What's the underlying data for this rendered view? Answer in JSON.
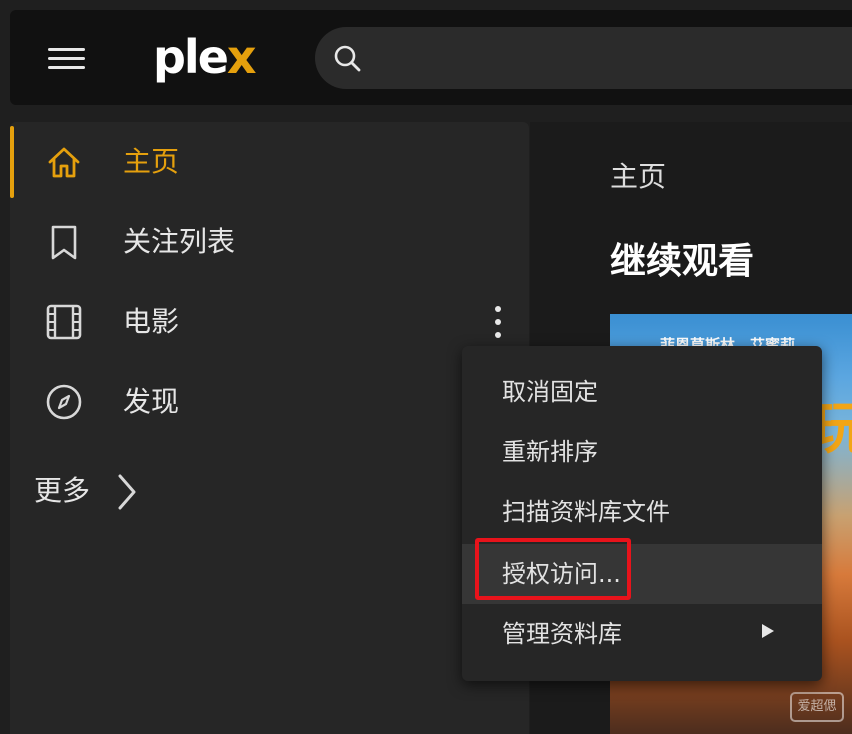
{
  "app": {
    "logo_text_main": "ple",
    "logo_text_accent": "x"
  },
  "search": {
    "placeholder": ""
  },
  "sidebar": {
    "items": [
      {
        "label": "主页",
        "icon": "home-icon",
        "active": true
      },
      {
        "label": "关注列表",
        "icon": "bookmark-icon",
        "active": false
      },
      {
        "label": "电影",
        "icon": "film-icon",
        "active": false
      },
      {
        "label": "发现",
        "icon": "compass-icon",
        "active": false
      }
    ],
    "more_label": "更多"
  },
  "main": {
    "breadcrumb": "主页",
    "section_title": "继续观看",
    "poster": {
      "names": "菲恩莫斯林　艾蜜莉",
      "title_fragment": "玩",
      "watermark": "爱超偲"
    }
  },
  "context_menu": {
    "items": [
      {
        "label": "取消固定"
      },
      {
        "label": "重新排序"
      },
      {
        "label": "扫描资料库文件"
      },
      {
        "label": "授权访问...",
        "highlighted": true
      },
      {
        "label": "管理资料库",
        "has_submenu": true
      }
    ]
  },
  "colors": {
    "accent": "#e5a00d",
    "annotation": "#e8131b",
    "background": "#1f1f1f"
  }
}
